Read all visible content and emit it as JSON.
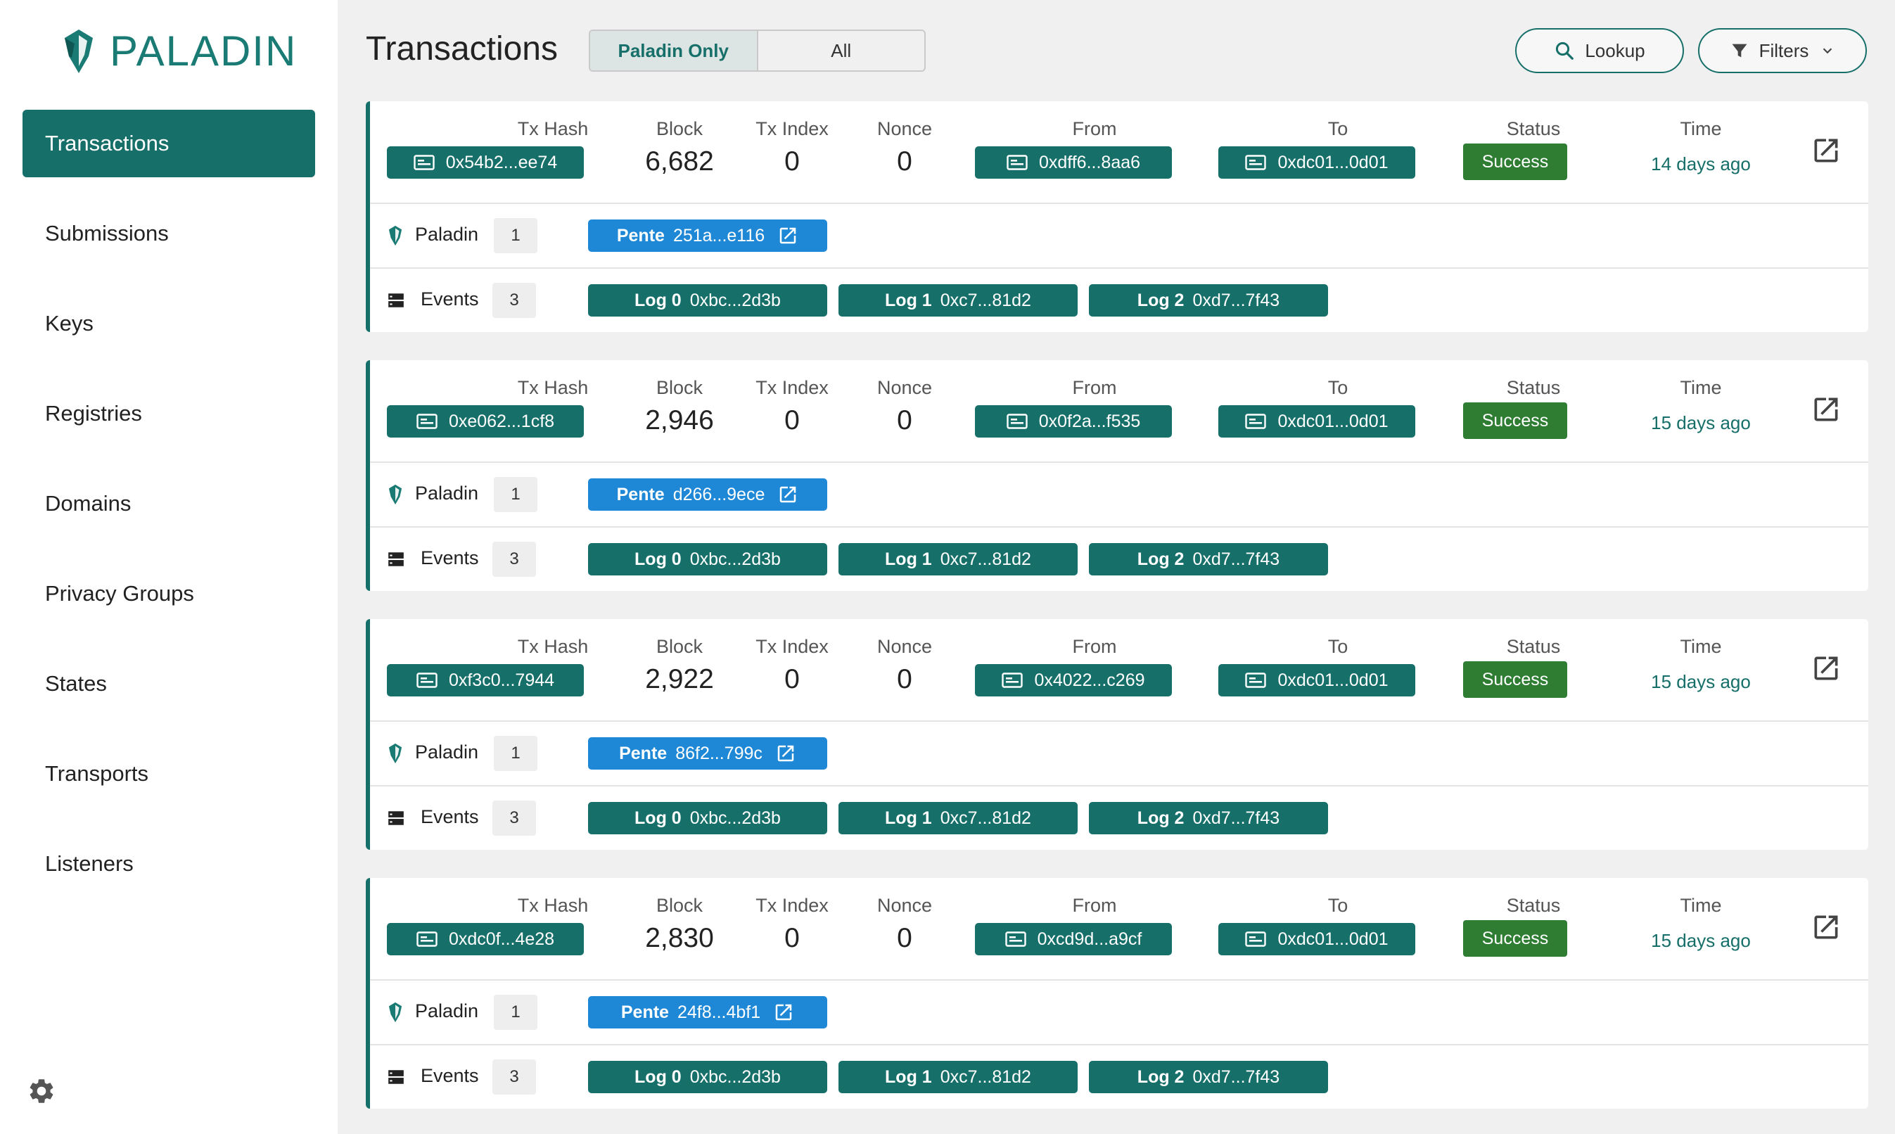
{
  "app": {
    "name": "PALADIN"
  },
  "sidebar": {
    "items": [
      {
        "label": "Transactions",
        "active": true
      },
      {
        "label": "Submissions",
        "active": false
      },
      {
        "label": "Keys",
        "active": false
      },
      {
        "label": "Registries",
        "active": false
      },
      {
        "label": "Domains",
        "active": false
      },
      {
        "label": "Privacy Groups",
        "active": false
      },
      {
        "label": "States",
        "active": false
      },
      {
        "label": "Transports",
        "active": false
      },
      {
        "label": "Listeners",
        "active": false
      }
    ]
  },
  "header": {
    "title": "Transactions",
    "segment": {
      "options": [
        "Paladin Only",
        "All"
      ],
      "selected": "Paladin Only"
    },
    "lookup_label": "Lookup",
    "filters_label": "Filters"
  },
  "columns": {
    "tx_hash": "Tx Hash",
    "block": "Block",
    "tx_index": "Tx Index",
    "nonce": "Nonce",
    "from": "From",
    "to": "To",
    "status": "Status",
    "time": "Time"
  },
  "row_labels": {
    "paladin": "Paladin",
    "events": "Events",
    "pente_prefix": "Pente"
  },
  "transactions": [
    {
      "tx_hash": "0x54b2...ee74",
      "block": "6,682",
      "tx_index": "0",
      "nonce": "0",
      "from": "0xdff6...8aa6",
      "to": "0xdc01...0d01",
      "status": "Success",
      "time": "14 days ago",
      "paladin_count": "1",
      "pente": "251a...e116",
      "events_count": "3",
      "logs": [
        {
          "label": "Log 0",
          "value": "0xbc...2d3b"
        },
        {
          "label": "Log 1",
          "value": "0xc7...81d2"
        },
        {
          "label": "Log 2",
          "value": "0xd7...7f43"
        }
      ]
    },
    {
      "tx_hash": "0xe062...1cf8",
      "block": "2,946",
      "tx_index": "0",
      "nonce": "0",
      "from": "0x0f2a...f535",
      "to": "0xdc01...0d01",
      "status": "Success",
      "time": "15 days ago",
      "paladin_count": "1",
      "pente": "d266...9ece",
      "events_count": "3",
      "logs": [
        {
          "label": "Log 0",
          "value": "0xbc...2d3b"
        },
        {
          "label": "Log 1",
          "value": "0xc7...81d2"
        },
        {
          "label": "Log 2",
          "value": "0xd7...7f43"
        }
      ]
    },
    {
      "tx_hash": "0xf3c0...7944",
      "block": "2,922",
      "tx_index": "0",
      "nonce": "0",
      "from": "0x4022...c269",
      "to": "0xdc01...0d01",
      "status": "Success",
      "time": "15 days ago",
      "paladin_count": "1",
      "pente": "86f2...799c",
      "events_count": "3",
      "logs": [
        {
          "label": "Log 0",
          "value": "0xbc...2d3b"
        },
        {
          "label": "Log 1",
          "value": "0xc7...81d2"
        },
        {
          "label": "Log 2",
          "value": "0xd7...7f43"
        }
      ]
    },
    {
      "tx_hash": "0xdc0f...4e28",
      "block": "2,830",
      "tx_index": "0",
      "nonce": "0",
      "from": "0xcd9d...a9cf",
      "to": "0xdc01...0d01",
      "status": "Success",
      "time": "15 days ago",
      "paladin_count": "1",
      "pente": "24f8...4bf1",
      "events_count": "3",
      "logs": [
        {
          "label": "Log 0",
          "value": "0xbc...2d3b"
        },
        {
          "label": "Log 1",
          "value": "0xc7...81d2"
        },
        {
          "label": "Log 2",
          "value": "0xd7...7f43"
        }
      ]
    }
  ],
  "colors": {
    "primary": "#176f69",
    "pente": "#1e88d6",
    "success": "#2e7d32"
  }
}
